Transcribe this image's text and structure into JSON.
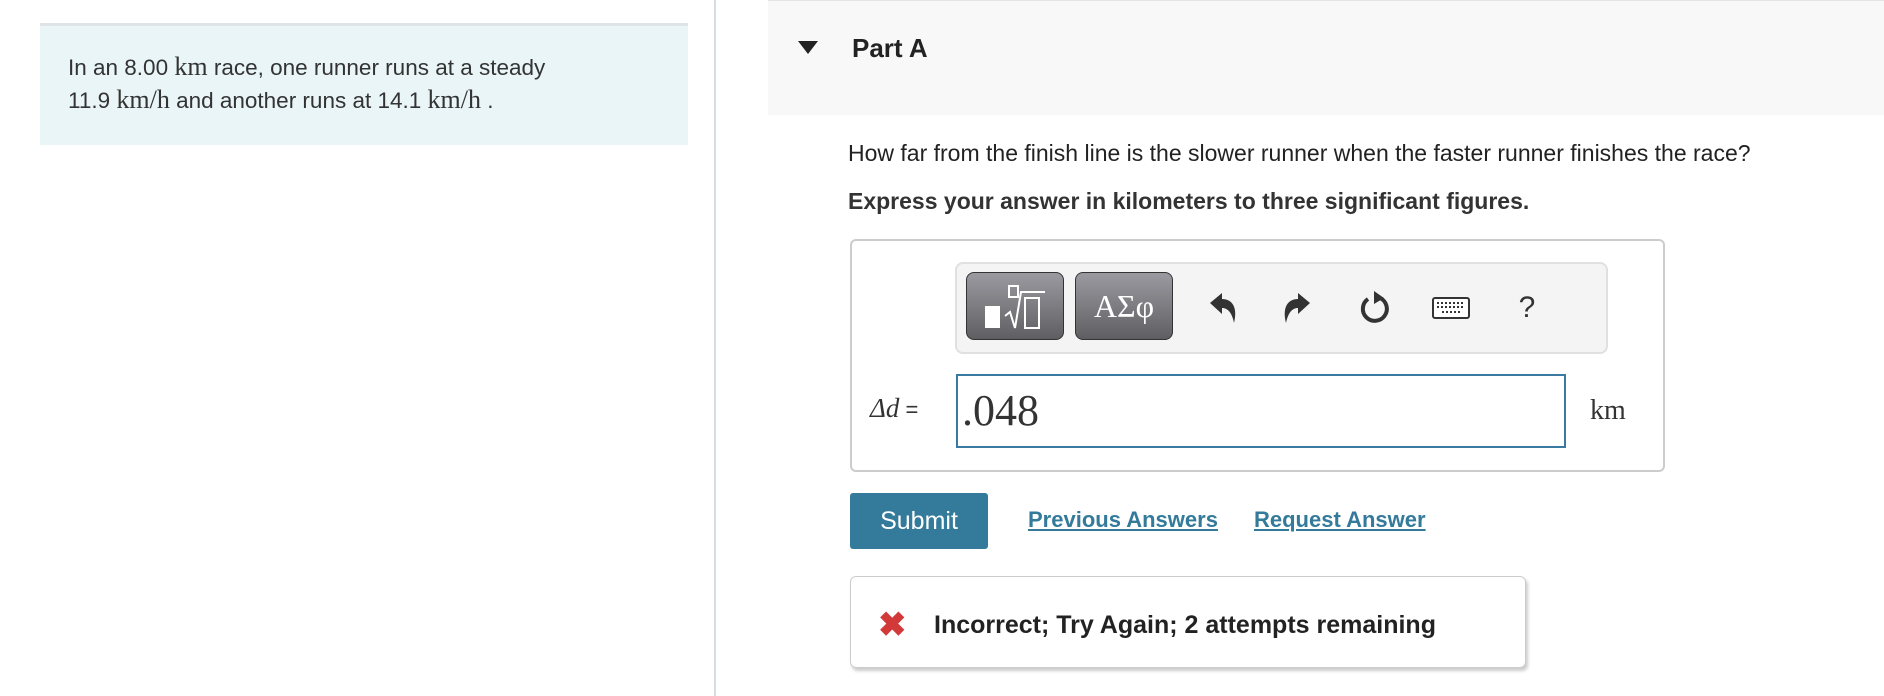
{
  "problem": {
    "text_1": "In an 8.00 ",
    "unit_km": "km",
    "text_2": " race, one runner runs at a steady",
    "speed_1": "11.9 ",
    "unit_kmh": "km/h",
    "text_3": " and another runs at 14.1 ",
    "text_4": " ."
  },
  "part": {
    "title": "Part A",
    "question": "How far from the finish line is the slower runner when the faster runner finishes the race?",
    "instruction": "Express your answer in kilometers to three significant figures."
  },
  "toolbar": {
    "templates_icon": "fraction-root-template-icon",
    "greek_label": "ΑΣφ",
    "undo_icon": "undo-icon",
    "redo_icon": "redo-icon",
    "reset_icon": "reset-icon",
    "keyboard_icon": "keyboard-icon",
    "help_label": "?"
  },
  "answer": {
    "variable": "Δd",
    "equals": " =",
    "value": ".048",
    "unit": "km"
  },
  "actions": {
    "submit": "Submit",
    "previous_answers": "Previous Answers",
    "request_answer": "Request Answer"
  },
  "feedback": {
    "icon": "x-icon",
    "text": "Incorrect; Try Again; 2 attempts remaining",
    "color": "#d23a3a"
  },
  "colors": {
    "accent": "#337a9b",
    "problem_bg": "#e9f5f7"
  }
}
